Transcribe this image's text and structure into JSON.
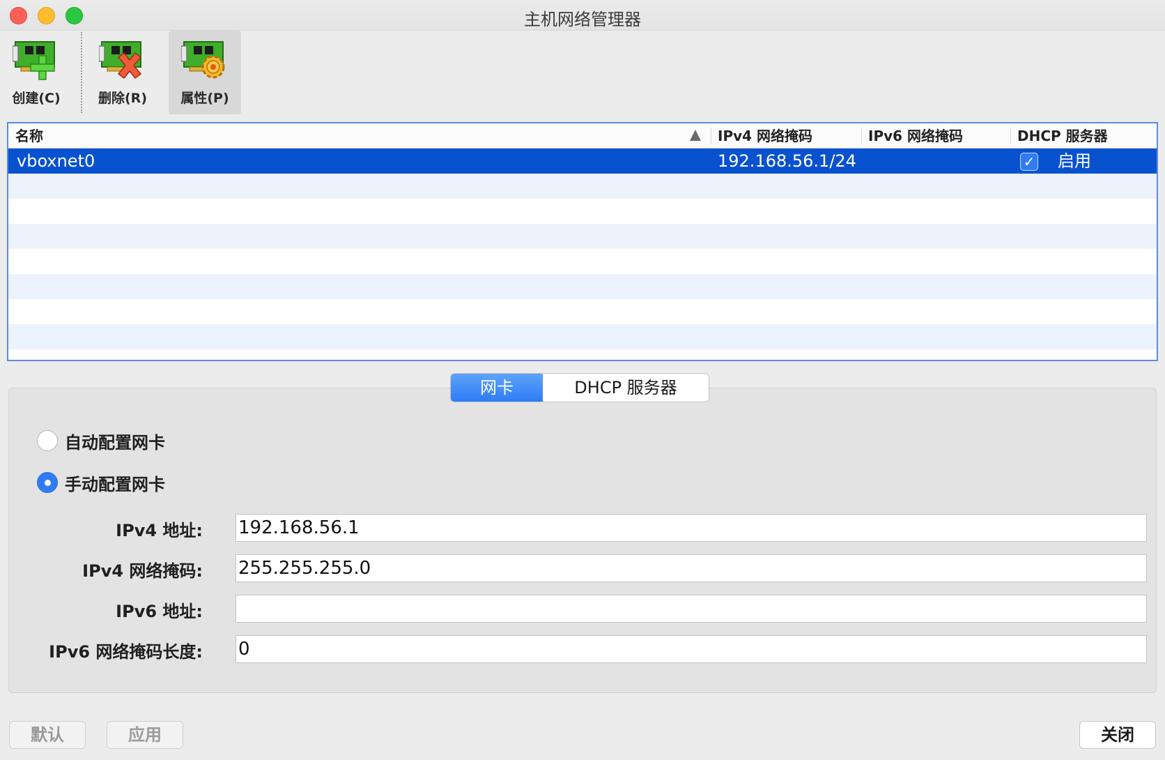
{
  "window": {
    "title": "主机网络管理器"
  },
  "toolbar": {
    "create_label": "创建(C)",
    "delete_label": "删除(R)",
    "properties_label": "属性(P)"
  },
  "table": {
    "columns": [
      "名称",
      "IPv4 网络掩码",
      "IPv6 网络掩码",
      "DHCP 服务器"
    ],
    "rows": [
      {
        "name": "vboxnet0",
        "ipv4_mask": "192.168.56.1/24",
        "ipv6_mask": "",
        "dhcp_enabled": true,
        "dhcp_label": "启用",
        "selected": true
      }
    ]
  },
  "tabs": {
    "adapter": "网卡",
    "dhcp": "DHCP 服务器"
  },
  "adapter": {
    "auto_label": "自动配置网卡",
    "manual_label": "手动配置网卡",
    "mode": "manual",
    "ipv4_address_label": "IPv4 地址:",
    "ipv4_address_value": "192.168.56.1",
    "ipv4_mask_label": "IPv4 网络掩码:",
    "ipv4_mask_value": "255.255.255.0",
    "ipv6_address_label": "IPv6 地址:",
    "ipv6_address_value": "",
    "ipv6_prefix_label": "IPv6 网络掩码长度:",
    "ipv6_prefix_value": "0"
  },
  "buttons": {
    "reset": "默认",
    "apply": "应用",
    "close": "关闭"
  },
  "colors": {
    "selection": "#0852d0",
    "accent": "#2f7cf6",
    "alt_row": "#edf3fd"
  }
}
